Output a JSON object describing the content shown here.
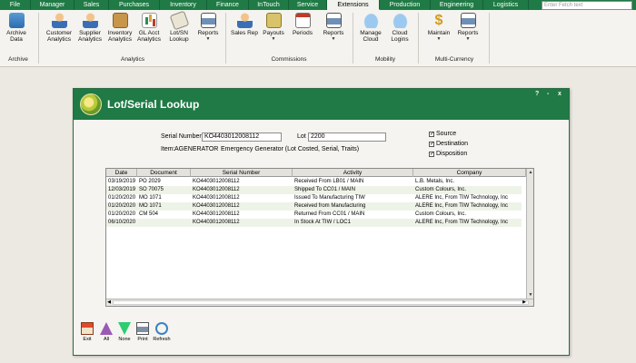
{
  "menu": {
    "tabs": [
      "File",
      "Manager",
      "Sales",
      "Purchases",
      "Inventory",
      "Finance",
      "InTouch",
      "Service",
      "Extensions",
      "Production",
      "Engineering",
      "Logistics"
    ],
    "active": "Extensions",
    "fetch_placeholder": "Enter Fetch text"
  },
  "ribbon": {
    "archive": {
      "btn": "Archive Data",
      "group": "Archive"
    },
    "analytics": {
      "buttons": [
        "Customer Analytics",
        "Supplier Analytics",
        "Inventory Analytics",
        "GL Acct Analytics",
        "Lot/SN Lookup",
        "Reports"
      ],
      "group": "Analytics"
    },
    "commissions": {
      "buttons": [
        "Sales Rep",
        "Payouts",
        "Periods",
        "Reports"
      ],
      "group": "Commissions"
    },
    "mobility": {
      "buttons": [
        "Manage Cloud",
        "Cloud Logins"
      ],
      "group": "Mobility"
    },
    "multicurrency": {
      "buttons": [
        "Maintain",
        "Reports"
      ],
      "group": "Multi-Currency"
    }
  },
  "dialog": {
    "title": "Lot/Serial Lookup",
    "controls": [
      "?",
      "-",
      "x"
    ],
    "serial_label": "Serial Number",
    "serial_value": "KO4403012008112",
    "lot_label": "Lot",
    "lot_value": "2200",
    "item_label": "Item:",
    "item_value": "AGENERATOR",
    "item_desc": "Emergency Generator (Lot Costed, Serial, Traits)",
    "checks": [
      "Source",
      "Destination",
      "Disposition"
    ],
    "columns": [
      "Date",
      "Document",
      "Serial Number",
      "Activity",
      "Company"
    ],
    "rows": [
      [
        "03/19/2019",
        "PO 2029",
        "KO4403012008112",
        "Received From LB01 / MAIN",
        "L.B. Metals, Inc."
      ],
      [
        "12/03/2019",
        "SO 70075",
        "KO4403012008112",
        "Shipped To CC01 / MAIN",
        "Custom Colours, Inc."
      ],
      [
        "01/20/2020",
        "MO 1071",
        "KO4403012008112",
        "Issued To Manufacturing TIW",
        "ALERE Inc, From TIW Technology, Inc"
      ],
      [
        "01/20/2020",
        "MO 1071",
        "KO4403012008112",
        "Received from Manufacturing",
        "ALERE Inc, From TIW Technology, Inc"
      ],
      [
        "01/20/2020",
        "CM 504",
        "KO4403012008112",
        "Returned From CC01 / MAIN",
        "Custom Colours, Inc."
      ],
      [
        "06/10/2020",
        "",
        "KO4403012008112",
        "In Stock At TIW / LOC1",
        "ALERE Inc, From TIW Technology, Inc"
      ]
    ],
    "toolbar": [
      "Exit",
      "All",
      "None",
      "Print",
      "Refresh"
    ]
  }
}
